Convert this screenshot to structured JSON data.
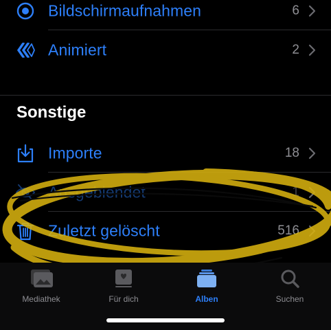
{
  "list": {
    "top_rows": [
      {
        "label": "Bildschirmaufnahmen",
        "count": "6",
        "icon": "record-icon"
      },
      {
        "label": "Animiert",
        "count": "2",
        "icon": "animated-icon"
      }
    ],
    "section_title": "Sonstige",
    "other_rows": [
      {
        "label": "Importe",
        "count": "18",
        "icon": "import-icon"
      },
      {
        "label": "Ausgeblendet",
        "count": "1",
        "icon": "hidden-eye-icon"
      },
      {
        "label": "Zuletzt gelöscht",
        "count": "516",
        "icon": "trash-icon"
      }
    ]
  },
  "tabbar": {
    "tabs": [
      {
        "label": "Mediathek",
        "icon": "photo-library-icon",
        "active": false
      },
      {
        "label": "Für dich",
        "icon": "for-you-icon",
        "active": false
      },
      {
        "label": "Alben",
        "icon": "albums-icon",
        "active": true
      },
      {
        "label": "Suchen",
        "icon": "search-icon",
        "active": false
      }
    ]
  },
  "colors": {
    "accent": "#2d7ff9",
    "background": "#000000",
    "secondary_text": "#8e8e93",
    "highlight_scribble": "#d6b10f"
  }
}
